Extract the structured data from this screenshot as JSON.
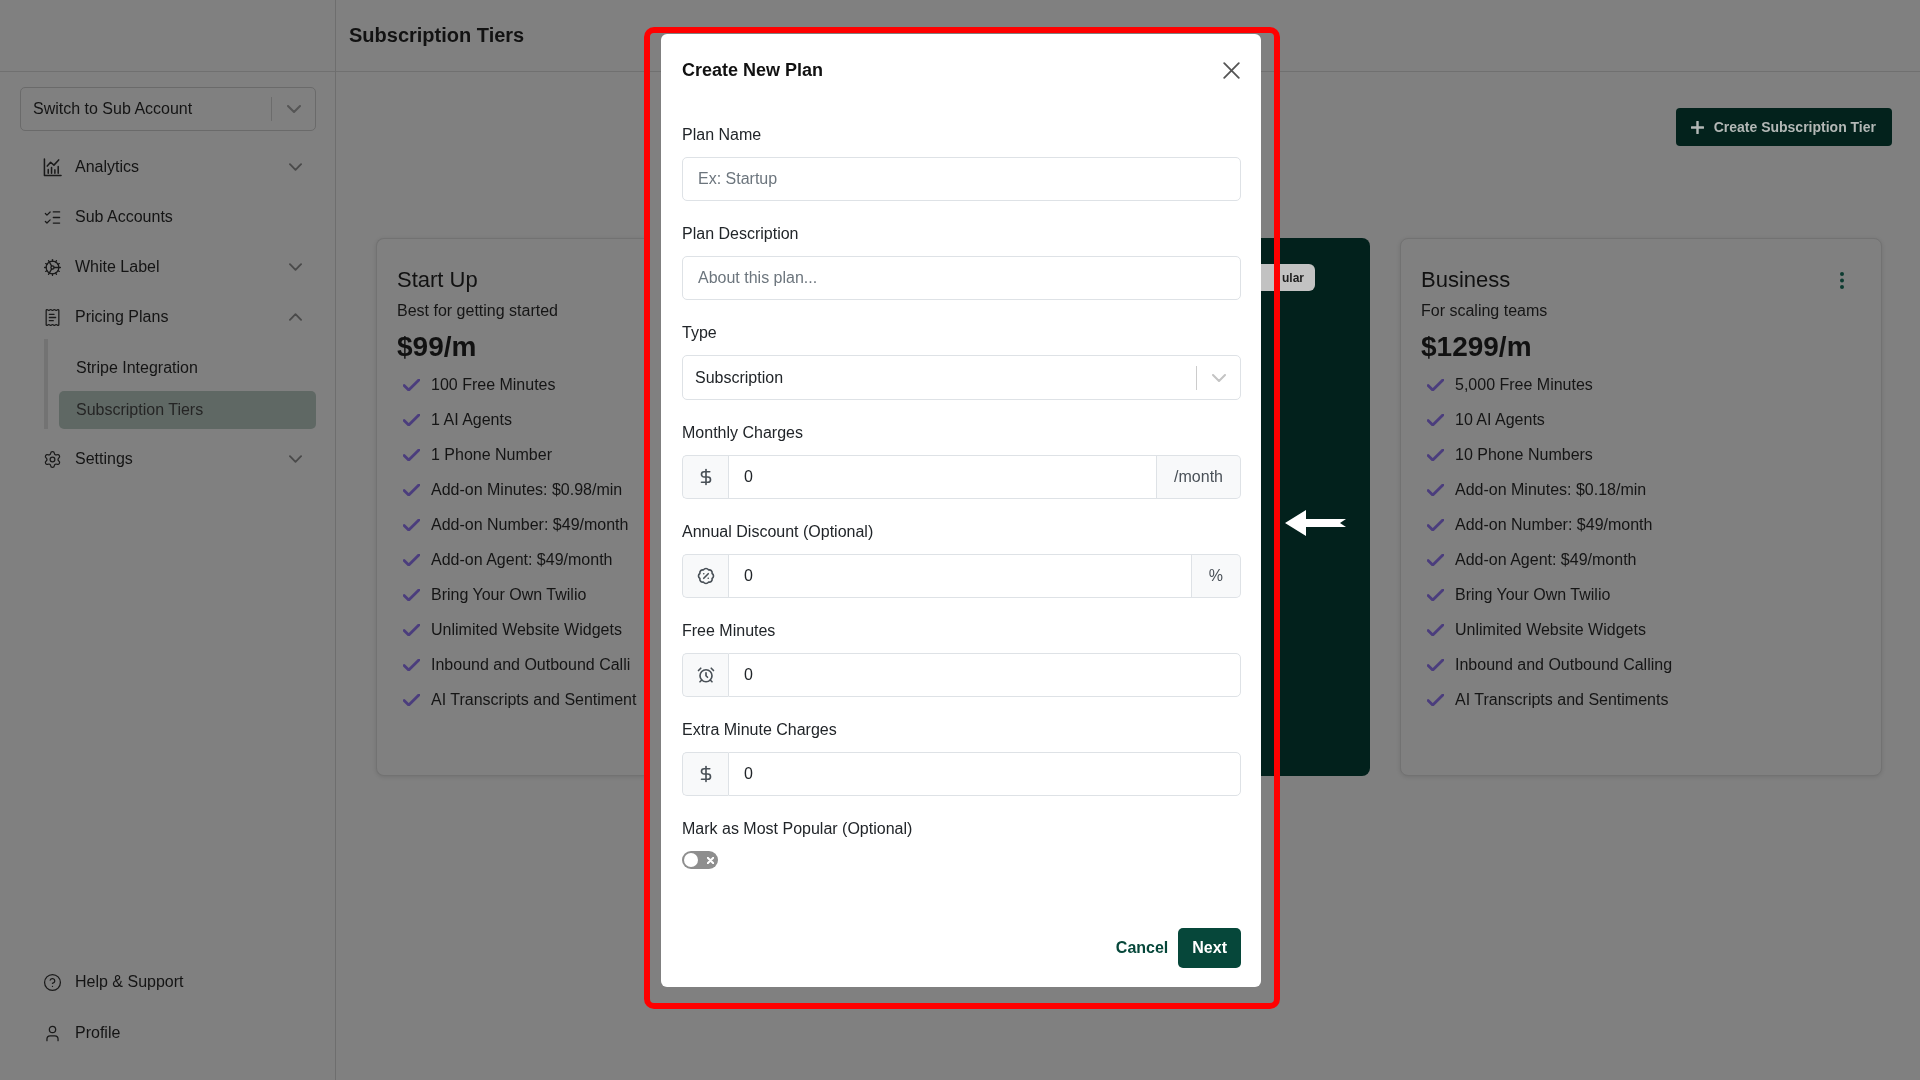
{
  "sidebar": {
    "account_select": {
      "value": "Switch to Sub Account"
    },
    "items": [
      {
        "kind": "group",
        "label": "Analytics",
        "expanded": false
      },
      {
        "kind": "link",
        "label": "Sub Accounts"
      },
      {
        "kind": "group",
        "label": "White Label",
        "expanded": false
      },
      {
        "kind": "group",
        "label": "Pricing Plans",
        "expanded": true,
        "children": [
          {
            "label": "Stripe Integration",
            "selected": false
          },
          {
            "label": "Subscription Tiers",
            "selected": true
          }
        ]
      },
      {
        "kind": "group",
        "label": "Settings",
        "expanded": false
      }
    ],
    "footer_items": [
      {
        "label": "Help & Support"
      },
      {
        "label": "Profile"
      }
    ]
  },
  "header": {
    "title": "Subscription Tiers"
  },
  "toolbar": {
    "create_button": "Create Subscription Tier"
  },
  "plans": [
    {
      "kind": "plan",
      "title": "Start Up",
      "subtitle": "Best for getting started",
      "price": "$99/m",
      "features": [
        "100 Free Minutes",
        "1 AI Agents",
        "1 Phone Number",
        "Add-on Minutes: $0.98/min",
        "Add-on Number: $49/month",
        "Add-on Agent: $49/month",
        "Bring Your Own Twilio",
        "Unlimited Website Widgets",
        "Inbound and Outbound Calli",
        "AI Transcripts and Sentiment"
      ]
    },
    {
      "kind": "popular",
      "badge": "ular"
    },
    {
      "kind": "plan",
      "title": "Business",
      "subtitle": "For scaling teams",
      "price": "$1299/m",
      "has_menu": true,
      "features": [
        "5,000 Free Minutes",
        "10 AI Agents",
        "10 Phone Numbers",
        "Add-on Minutes: $0.18/min",
        "Add-on Number: $49/month",
        "Add-on Agent: $49/month",
        "Bring Your Own Twilio",
        "Unlimited Website Widgets",
        "Inbound and Outbound Calling",
        "AI Transcripts and Sentiments"
      ]
    }
  ],
  "dialog": {
    "title": "Create New Plan",
    "fields": [
      {
        "kind": "text",
        "label": "Plan Name",
        "placeholder": "Ex: Startup"
      },
      {
        "kind": "text",
        "label": "Plan Description",
        "placeholder": "About this plan..."
      },
      {
        "kind": "select",
        "label": "Type",
        "value": "Subscription"
      },
      {
        "kind": "addon",
        "label": "Monthly Charges",
        "value": "0",
        "suffix": "/month"
      },
      {
        "kind": "addon",
        "label": "Annual Discount (Optional)",
        "value": "0",
        "suffix": "%"
      },
      {
        "kind": "addon",
        "label": "Free Minutes",
        "value": "0"
      },
      {
        "kind": "addon",
        "label": "Extra Minute Charges",
        "value": "0"
      },
      {
        "kind": "toggle",
        "label": "Mark as Most Popular (Optional)",
        "on": false
      }
    ],
    "buttons": [
      {
        "kind": "cancel",
        "label": "Cancel"
      },
      {
        "kind": "submit",
        "label": "Next"
      }
    ]
  }
}
